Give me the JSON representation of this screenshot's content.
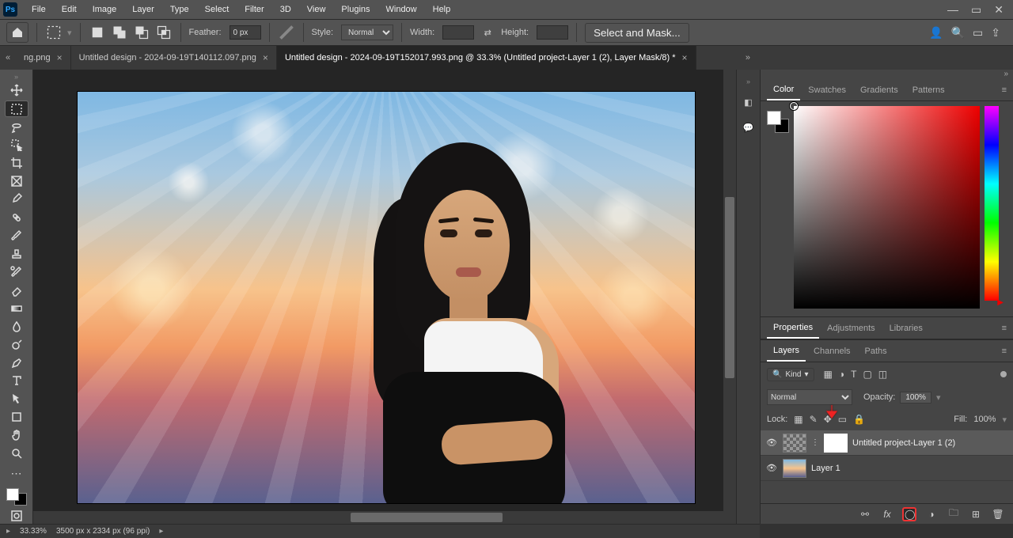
{
  "menu": {
    "items": [
      "File",
      "Edit",
      "Image",
      "Layer",
      "Type",
      "Select",
      "Filter",
      "3D",
      "View",
      "Plugins",
      "Window",
      "Help"
    ]
  },
  "options": {
    "feather_label": "Feather:",
    "feather_value": "0 px",
    "style_label": "Style:",
    "style_value": "Normal",
    "width_label": "Width:",
    "height_label": "Height:",
    "select_mask": "Select and Mask..."
  },
  "tabs": {
    "left_trunc": "ng.png",
    "mid": "Untitled design - 2024-09-19T140112.097.png",
    "active": "Untitled design - 2024-09-19T152017.993.png @ 33.3% (Untitled project-Layer 1 (2), Layer Mask/8) *"
  },
  "status": {
    "zoom": "33.33%",
    "dims": "3500 px x 2334 px (96 ppi)"
  },
  "panels": {
    "color_tabs": [
      "Color",
      "Swatches",
      "Gradients",
      "Patterns"
    ],
    "props_tabs": [
      "Properties",
      "Adjustments",
      "Libraries"
    ],
    "layers_tabs": [
      "Layers",
      "Channels",
      "Paths"
    ],
    "kind": "Kind",
    "blend": "Normal",
    "opacity_label": "Opacity:",
    "opacity_value": "100%",
    "lock_label": "Lock:",
    "fill_label": "Fill:",
    "fill_value": "100%"
  },
  "layers": [
    {
      "name": "Untitled project-Layer 1 (2)",
      "has_mask": true,
      "selected": true,
      "thumb": "checker"
    },
    {
      "name": "Layer 1",
      "has_mask": false,
      "selected": false,
      "thumb": "sky"
    }
  ]
}
